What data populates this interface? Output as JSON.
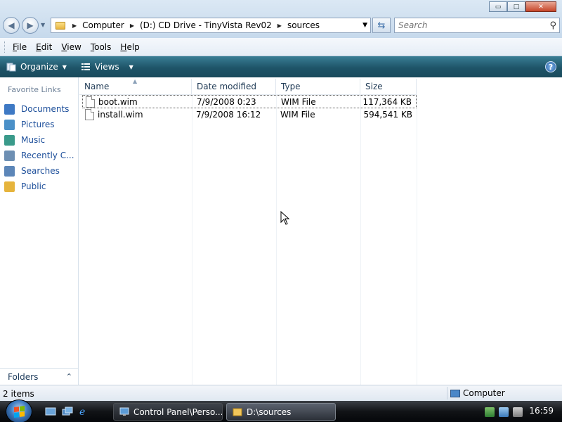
{
  "window": {
    "controls": {
      "minimize": "▭",
      "maximize": "□",
      "close": "✕"
    }
  },
  "address_bar": {
    "crumbs": [
      "Computer",
      "(D:) CD Drive - TinyVista Rev02",
      "sources"
    ]
  },
  "search": {
    "placeholder": "Search"
  },
  "menu": [
    "File",
    "Edit",
    "View",
    "Tools",
    "Help"
  ],
  "commands": {
    "organize": "Organize",
    "views": "Views",
    "help": "?"
  },
  "nav_pane": {
    "title": "Favorite Links",
    "links": [
      {
        "label": "Documents",
        "color": "#3e79c4"
      },
      {
        "label": "Pictures",
        "color": "#4a90c8"
      },
      {
        "label": "Music",
        "color": "#3a9a8a"
      },
      {
        "label": "Recently C...",
        "color": "#6d8fb3"
      },
      {
        "label": "Searches",
        "color": "#5c86b8"
      },
      {
        "label": "Public",
        "color": "#e6b43c"
      }
    ],
    "folders_label": "Folders"
  },
  "file_list": {
    "columns": [
      "Name",
      "Date modified",
      "Type",
      "Size"
    ],
    "rows": [
      {
        "name": "boot.wim",
        "date": "7/9/2008 0:23",
        "type": "WIM File",
        "size": "117,364 KB"
      },
      {
        "name": "install.wim",
        "date": "7/9/2008 16:12",
        "type": "WIM File",
        "size": "594,541 KB"
      }
    ]
  },
  "status_bar": {
    "count": "2 items",
    "location": "Computer"
  },
  "taskbar": {
    "tasks": [
      {
        "label": "Control Panel\\Perso..."
      },
      {
        "label": "D:\\sources"
      }
    ],
    "clock": "16:59"
  }
}
